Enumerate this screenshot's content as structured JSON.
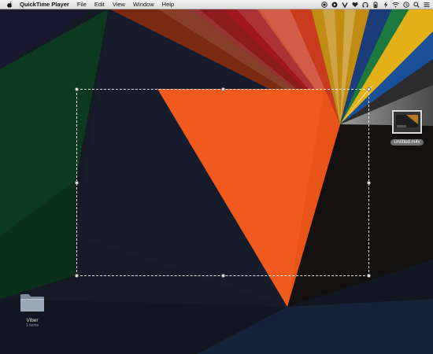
{
  "menubar": {
    "app_name": "QuickTime Player",
    "items": [
      "File",
      "Edit",
      "View",
      "Window",
      "Help"
    ],
    "status_icons": [
      "record-icon",
      "play-circle-icon",
      "vine-icon",
      "heart-icon",
      "headphones-icon",
      "battery-icon",
      "lightning-icon",
      "wifi-icon",
      "time-machine-icon",
      "search-icon",
      "list-icon"
    ]
  },
  "desktop": {
    "file": {
      "name": "Untitled.m4v"
    },
    "folder": {
      "name": "Viber",
      "count": "1 items"
    }
  },
  "colors": {
    "menubar_bg": "#e8e8e8",
    "wallpaper_base": "#141a26",
    "wallpaper_orange": "#f05a1c",
    "wallpaper_navy": "#1c2235",
    "wallpaper_green": "#0d3a1e",
    "selection_border": "#ffffff"
  }
}
